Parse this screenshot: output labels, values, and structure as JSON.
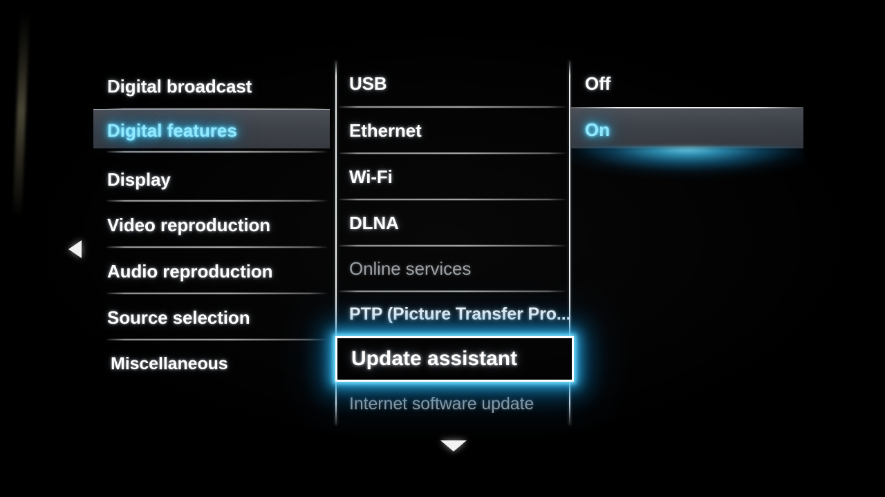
{
  "screen": {
    "title": "TV Settings Menu",
    "background_color": "#000000",
    "accent_color": "#3fc8f5",
    "highlight_bar_color": "#3c4047",
    "dim_text_color": "#9a9ea3",
    "text_color": "#ffffff"
  },
  "columns": {
    "categories": {
      "name": "categories-column",
      "selected_index": 1,
      "items": [
        {
          "label": "Digital broadcast",
          "state": "normal"
        },
        {
          "label": "Digital features",
          "state": "selected"
        },
        {
          "label": "Display",
          "state": "normal"
        },
        {
          "label": "Video reproduction",
          "state": "normal"
        },
        {
          "label": "Audio reproduction",
          "state": "normal"
        },
        {
          "label": "Source selection",
          "state": "normal"
        },
        {
          "label": "Miscellaneous",
          "state": "normal"
        }
      ]
    },
    "features": {
      "name": "digital-features-column",
      "focused_index": 6,
      "items": [
        {
          "label": "USB",
          "state": "normal"
        },
        {
          "label": "Ethernet",
          "state": "normal"
        },
        {
          "label": "Wi-Fi",
          "state": "normal"
        },
        {
          "label": "DLNA",
          "state": "normal"
        },
        {
          "label": "Online services",
          "state": "disabled"
        },
        {
          "label": "PTP (Picture Transfer Pro...",
          "state": "normal"
        },
        {
          "label": "Update assistant",
          "state": "focused"
        },
        {
          "label": "Internet software update",
          "state": "disabled"
        }
      ]
    },
    "values": {
      "name": "update-assistant-values-column",
      "selected_index": 1,
      "items": [
        {
          "label": "Off",
          "state": "normal"
        },
        {
          "label": "On",
          "state": "selected"
        }
      ]
    }
  },
  "navigation": {
    "left_arrow": "arrow-left-icon",
    "down_arrow": "arrow-down-icon"
  }
}
